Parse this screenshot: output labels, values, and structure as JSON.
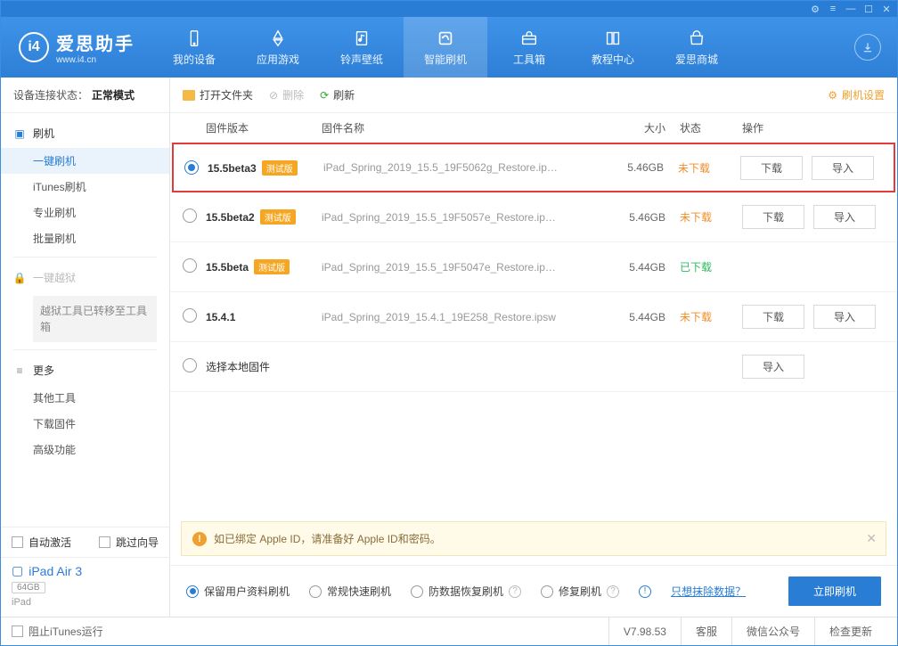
{
  "titlebar": {
    "icons": [
      "⚙",
      "≡",
      "—",
      "☐",
      "✕"
    ]
  },
  "logo": {
    "title": "爱思助手",
    "subtitle": "www.i4.cn",
    "glyph": "i4"
  },
  "nav": [
    {
      "label": "我的设备"
    },
    {
      "label": "应用游戏"
    },
    {
      "label": "铃声壁纸"
    },
    {
      "label": "智能刷机",
      "active": true
    },
    {
      "label": "工具箱"
    },
    {
      "label": "教程中心"
    },
    {
      "label": "爱思商城"
    }
  ],
  "sidebar": {
    "conn_label": "设备连接状态：",
    "conn_value": "正常模式",
    "group_flash": "刷机",
    "items_flash": [
      "一键刷机",
      "iTunes刷机",
      "专业刷机",
      "批量刷机"
    ],
    "group_jail": "一键越狱",
    "jail_note": "越狱工具已转移至工具箱",
    "group_more": "更多",
    "items_more": [
      "其他工具",
      "下载固件",
      "高级功能"
    ],
    "auto_activate": "自动激活",
    "skip_guide": "跳过向导",
    "device_name": "iPad Air 3",
    "device_storage": "64GB",
    "device_type": "iPad"
  },
  "toolbar": {
    "open": "打开文件夹",
    "delete": "删除",
    "refresh": "刷新",
    "settings": "刷机设置"
  },
  "table": {
    "headers": {
      "version": "固件版本",
      "name": "固件名称",
      "size": "大小",
      "state": "状态",
      "ops": "操作"
    },
    "download_btn": "下载",
    "import_btn": "导入",
    "state_no": "未下载",
    "state_done": "已下载",
    "beta_tag": "测试版",
    "local_label": "选择本地固件",
    "rows": [
      {
        "selected": true,
        "version": "15.5beta3",
        "beta": true,
        "file": "iPad_Spring_2019_15.5_19F5062g_Restore.ip…",
        "size": "5.46GB",
        "state": "no",
        "ops": [
          "download",
          "import"
        ]
      },
      {
        "selected": false,
        "version": "15.5beta2",
        "beta": true,
        "file": "iPad_Spring_2019_15.5_19F5057e_Restore.ip…",
        "size": "5.46GB",
        "state": "no",
        "ops": [
          "download",
          "import"
        ]
      },
      {
        "selected": false,
        "version": "15.5beta",
        "beta": true,
        "file": "iPad_Spring_2019_15.5_19F5047e_Restore.ip…",
        "size": "5.44GB",
        "state": "done",
        "ops": []
      },
      {
        "selected": false,
        "version": "15.4.1",
        "beta": false,
        "file": "iPad_Spring_2019_15.4.1_19E258_Restore.ipsw",
        "size": "5.44GB",
        "state": "no",
        "ops": [
          "download",
          "import"
        ]
      }
    ]
  },
  "notice": "如已绑定 Apple ID，请准备好 Apple ID和密码。",
  "options": {
    "items": [
      {
        "label": "保留用户资料刷机",
        "selected": true
      },
      {
        "label": "常规快速刷机",
        "selected": false
      },
      {
        "label": "防数据恢复刷机",
        "selected": false,
        "help": true
      },
      {
        "label": "修复刷机",
        "selected": false,
        "help": true
      }
    ],
    "erase_link": "只想抹除数据？",
    "start": "立即刷机"
  },
  "statusbar": {
    "block_itunes": "阻止iTunes运行",
    "version": "V7.98.53",
    "support": "客服",
    "wechat": "微信公众号",
    "update": "检查更新"
  }
}
